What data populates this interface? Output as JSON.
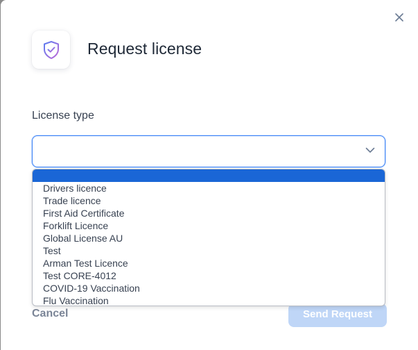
{
  "modal": {
    "title": "Request license",
    "icon": "shield-check-icon",
    "close_icon": "close-icon"
  },
  "form": {
    "license_type_label": "License type",
    "license_type_value": "",
    "options": [
      "",
      "Drivers licence",
      "Trade licence",
      "First Aid Certificate",
      "Forklift Licence",
      "Global License AU",
      "Test",
      "Arman Test Licence",
      "Test CORE-4012",
      "COVID-19 Vaccination",
      "Flu Vaccination"
    ]
  },
  "footer": {
    "cancel_label": "Cancel",
    "send_label": "Send Request"
  },
  "colors": {
    "accent": "#3b82f6",
    "highlight": "#1a66d6",
    "send_disabled": "#bfd6f7"
  }
}
